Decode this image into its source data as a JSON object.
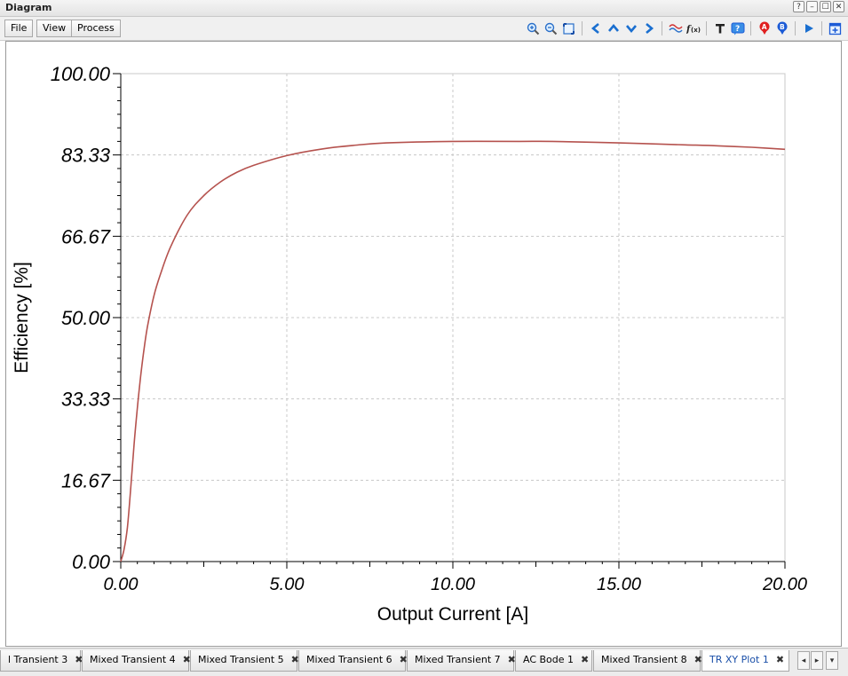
{
  "window": {
    "title": "Diagram",
    "buttons": {
      "help": "?",
      "minimize": "–",
      "maximize": "☐",
      "close": "✕"
    }
  },
  "menu": {
    "file": "File",
    "view": "View",
    "process": "Process"
  },
  "toolbar_icons": [
    "zoom-in-icon",
    "zoom-out-icon",
    "fit-to-window-icon",
    "arrow-left-icon",
    "arrow-up-icon",
    "arrow-down-icon",
    "arrow-right-icon",
    "waveform-icon",
    "function-icon",
    "text-icon",
    "help-icon",
    "marker-a-icon",
    "marker-b-icon",
    "play-icon",
    "add-plot-icon"
  ],
  "colors": {
    "curve": "#b5524e",
    "grid": "#c8c8c8",
    "accent": "#1a6fd0",
    "marker_a": "#e02020",
    "marker_b": "#1c5bd6"
  },
  "tabs": [
    {
      "label": "l Transient 3",
      "active": false
    },
    {
      "label": "Mixed Transient 4",
      "active": false
    },
    {
      "label": "Mixed Transient 5",
      "active": false
    },
    {
      "label": "Mixed Transient 6",
      "active": false
    },
    {
      "label": "Mixed Transient 7",
      "active": false
    },
    {
      "label": "AC Bode 1",
      "active": false
    },
    {
      "label": "Mixed Transient 8",
      "active": false
    },
    {
      "label": "TR XY Plot 1",
      "active": true
    }
  ],
  "tab_scroll": {
    "left": "◂",
    "right": "▸",
    "menu": "▾"
  },
  "chart_data": {
    "type": "line",
    "xlabel": "Output Current [A]",
    "ylabel": "Efficiency [%]",
    "xlim": [
      0,
      20
    ],
    "ylim": [
      0,
      100
    ],
    "xticks": [
      "0.00",
      "5.00",
      "10.00",
      "15.00",
      "20.00"
    ],
    "yticks": [
      "0.00",
      "16.67",
      "33.33",
      "50.00",
      "66.67",
      "83.33",
      "100.00"
    ],
    "grid": true,
    "series": [
      {
        "x": [
          0,
          0.1,
          0.2,
          0.3,
          0.4,
          0.5,
          0.6,
          0.7,
          0.8,
          1.0,
          1.2,
          1.5,
          2.0,
          2.5,
          3.0,
          3.5,
          4.0,
          5.0,
          6.0,
          7.0,
          8.0,
          10.0,
          12.0,
          13.0,
          15.0,
          17.0,
          18.0,
          19.0,
          20.0
        ],
        "y": [
          0,
          2.5,
          7,
          15,
          24,
          31.5,
          38,
          43.5,
          48,
          54.5,
          59,
          64.5,
          71,
          75,
          77.8,
          79.8,
          81.2,
          83.2,
          84.5,
          85.3,
          85.8,
          86.1,
          86.1,
          86.1,
          85.8,
          85.4,
          85.2,
          84.9,
          84.5
        ]
      }
    ]
  }
}
